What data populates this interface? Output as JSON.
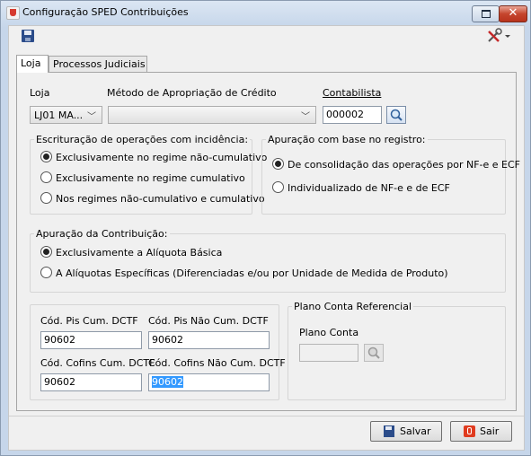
{
  "window": {
    "title": "Configuração SPED Contribuições"
  },
  "tabs": [
    {
      "label": "Loja"
    },
    {
      "label": "Processos Judiciais"
    }
  ],
  "loja": {
    "label": "Loja",
    "value": "LJ01 MA..."
  },
  "metodo": {
    "label": "Método de Apropriação de Crédito",
    "value": ""
  },
  "contabilista": {
    "label": "Contabilista",
    "value": "000002"
  },
  "escrituracao": {
    "title": "Escrituração de operações com incidência:",
    "options": [
      {
        "label": "Exclusivamente no regime não-cumulativo",
        "selected": true
      },
      {
        "label": "Exclusivamente no regime cumulativo",
        "selected": false
      },
      {
        "label": "Nos regimes não-cumulativo e cumulativo",
        "selected": false
      }
    ]
  },
  "apuracao_registro": {
    "title": "Apuração com base no registro:",
    "options": [
      {
        "label": "De consolidação das operações por NF-e e ECF",
        "selected": true
      },
      {
        "label": "Individualizado de NF-e e de ECF",
        "selected": false
      }
    ]
  },
  "apuracao_contribuicao": {
    "title": "Apuração da Contribuição:",
    "options": [
      {
        "label": "Exclusivamente a Alíquota Básica",
        "selected": true
      },
      {
        "label": "A Alíquotas Específicas (Diferenciadas e/ou por Unidade de Medida de Produto)",
        "selected": false
      }
    ]
  },
  "codigos": {
    "pis_cum": {
      "label": "Cód. Pis Cum. DCTF",
      "value": "90602"
    },
    "pis_nao_cum": {
      "label": "Cód. Pis Não Cum. DCTF",
      "value": "90602"
    },
    "cofins_cum": {
      "label": "Cód. Cofins Cum. DCTF",
      "value": "90602"
    },
    "cofins_nao_cum": {
      "label": "Cód. Cofins Não Cum. DCTF",
      "value": "90602"
    }
  },
  "plano_conta_ref": {
    "title": "Plano Conta Referencial",
    "label": "Plano Conta",
    "value": ""
  },
  "buttons": {
    "save": "Salvar",
    "exit": "Sair"
  },
  "icons": {
    "window": "app-cup-icon",
    "save": "floppy-disk-icon",
    "tools": "tools-icon",
    "search": "magnifier-icon",
    "exit": "exit-icon"
  },
  "colors": {
    "selection": "#3399ff",
    "close_button": "#c5452d"
  }
}
